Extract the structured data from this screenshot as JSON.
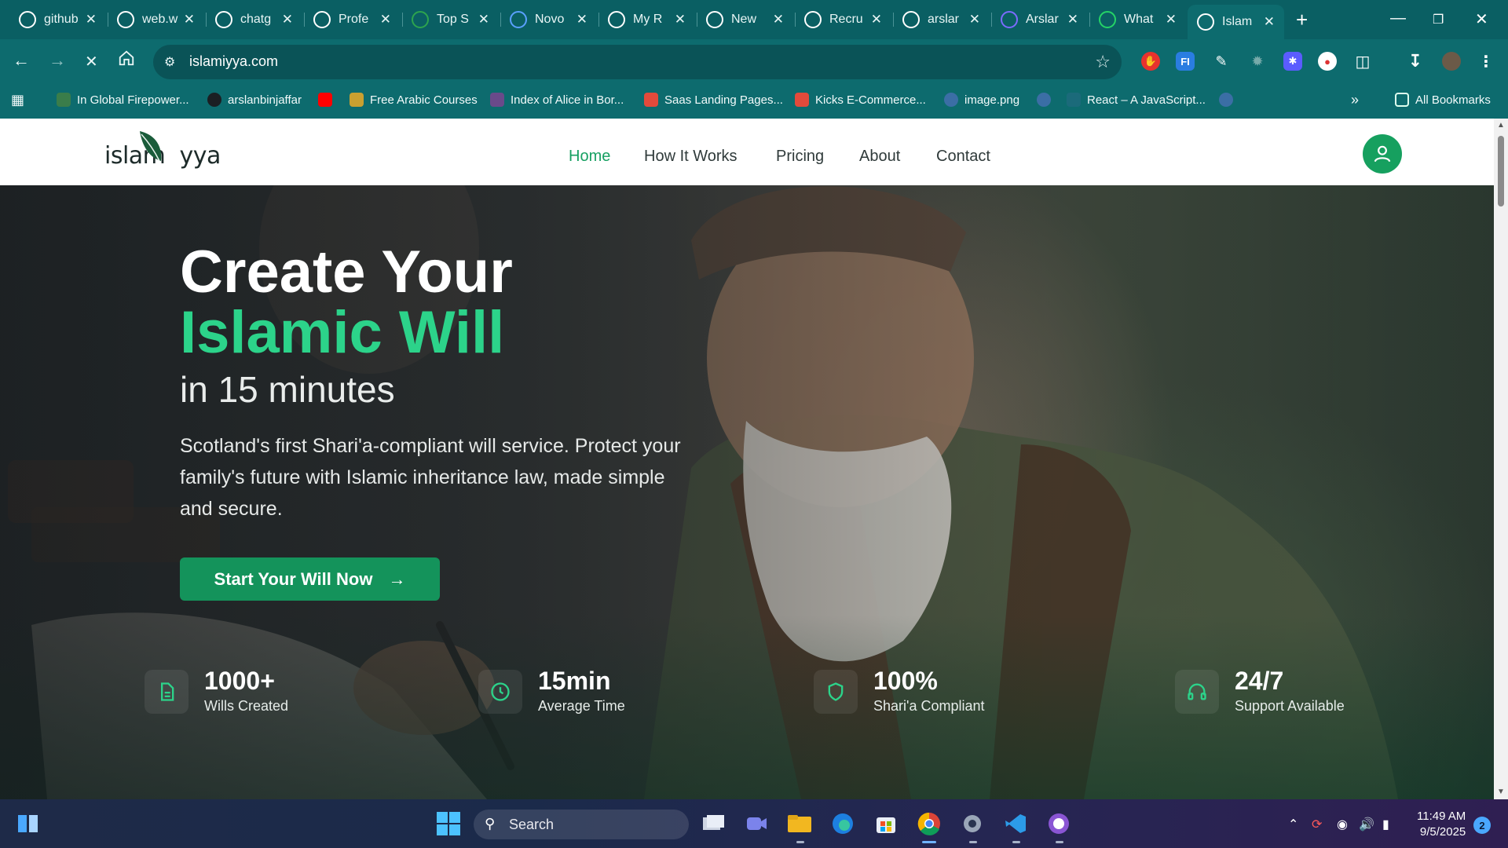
{
  "browser": {
    "tabs": [
      {
        "title": "github",
        "icon": "github-icon",
        "color": "#ffffff"
      },
      {
        "title": "web.w",
        "icon": "whatsapp-icon",
        "color": "#ffffff"
      },
      {
        "title": "chatg",
        "icon": "chatgpt-icon",
        "color": "#ffffff"
      },
      {
        "title": "Profe",
        "icon": "chatgpt-icon",
        "color": "#ffffff"
      },
      {
        "title": "Top S",
        "icon": "sheets-icon",
        "color": "#2da44e"
      },
      {
        "title": "Novo",
        "icon": "notion-n-icon",
        "color": "#5aa0ff"
      },
      {
        "title": "My R",
        "icon": "globe-icon",
        "color": "#ffffff"
      },
      {
        "title": "New",
        "icon": "chatgpt-icon",
        "color": "#ffffff"
      },
      {
        "title": "Recru",
        "icon": "chatgpt-icon",
        "color": "#ffffff"
      },
      {
        "title": "arslar",
        "icon": "github-icon",
        "color": "#ffffff"
      },
      {
        "title": "Arslar",
        "icon": "globe-icon",
        "color": "#7b6bff"
      },
      {
        "title": "What",
        "icon": "whatsapp-icon",
        "color": "#25d366"
      },
      {
        "title": "Islam",
        "icon": "loading-icon",
        "color": "#ffffff"
      }
    ],
    "url": "islamiyya.com",
    "bookmarks": [
      {
        "label": "In Global Firepower...",
        "icon": "gfp-icon"
      },
      {
        "label": "arslanbinjaffar",
        "icon": "github-icon"
      },
      {
        "label": "",
        "icon": "youtube-icon"
      },
      {
        "label": "Free Arabic Courses",
        "icon": "courses-icon"
      },
      {
        "label": "Index of Alice in Bor...",
        "icon": "folder-icon"
      },
      {
        "label": "Saas Landing Pages...",
        "icon": "figma-icon"
      },
      {
        "label": "Kicks E-Commerce...",
        "icon": "figma-icon"
      },
      {
        "label": "image.png",
        "icon": "globe-icon"
      },
      {
        "label": "",
        "icon": "globe-icon"
      },
      {
        "label": "React – A JavaScript...",
        "icon": "react-icon"
      },
      {
        "label": "",
        "icon": "globe-icon"
      }
    ],
    "all_bookmarks": "All Bookmarks"
  },
  "site": {
    "logo_text": "islam  yya",
    "nav": [
      "Home",
      "How It Works",
      "Pricing",
      "About",
      "Contact"
    ],
    "active_nav": "Home",
    "hero": {
      "line1": "Create Your",
      "line2": "Islamic Will",
      "line3": "in 15 minutes",
      "description": "Scotland's first Shari'a-compliant will service. Protect your family's future with Islamic inheritance law, made simple and secure.",
      "cta": "Start Your Will Now",
      "accent": "#2cd38a",
      "cta_color": "#14935b"
    },
    "stats": [
      {
        "value": "1000+",
        "label": "Wills Created",
        "icon": "document-icon"
      },
      {
        "value": "15min",
        "label": "Average Time",
        "icon": "clock-icon"
      },
      {
        "value": "100%",
        "label": "Shari'a Compliant",
        "icon": "shield-icon"
      },
      {
        "value": "24/7",
        "label": "Support Available",
        "icon": "headphones-icon"
      }
    ]
  },
  "taskbar": {
    "search": "Search",
    "time": "11:49 AM",
    "date": "9/5/2025",
    "notifications": "2"
  }
}
